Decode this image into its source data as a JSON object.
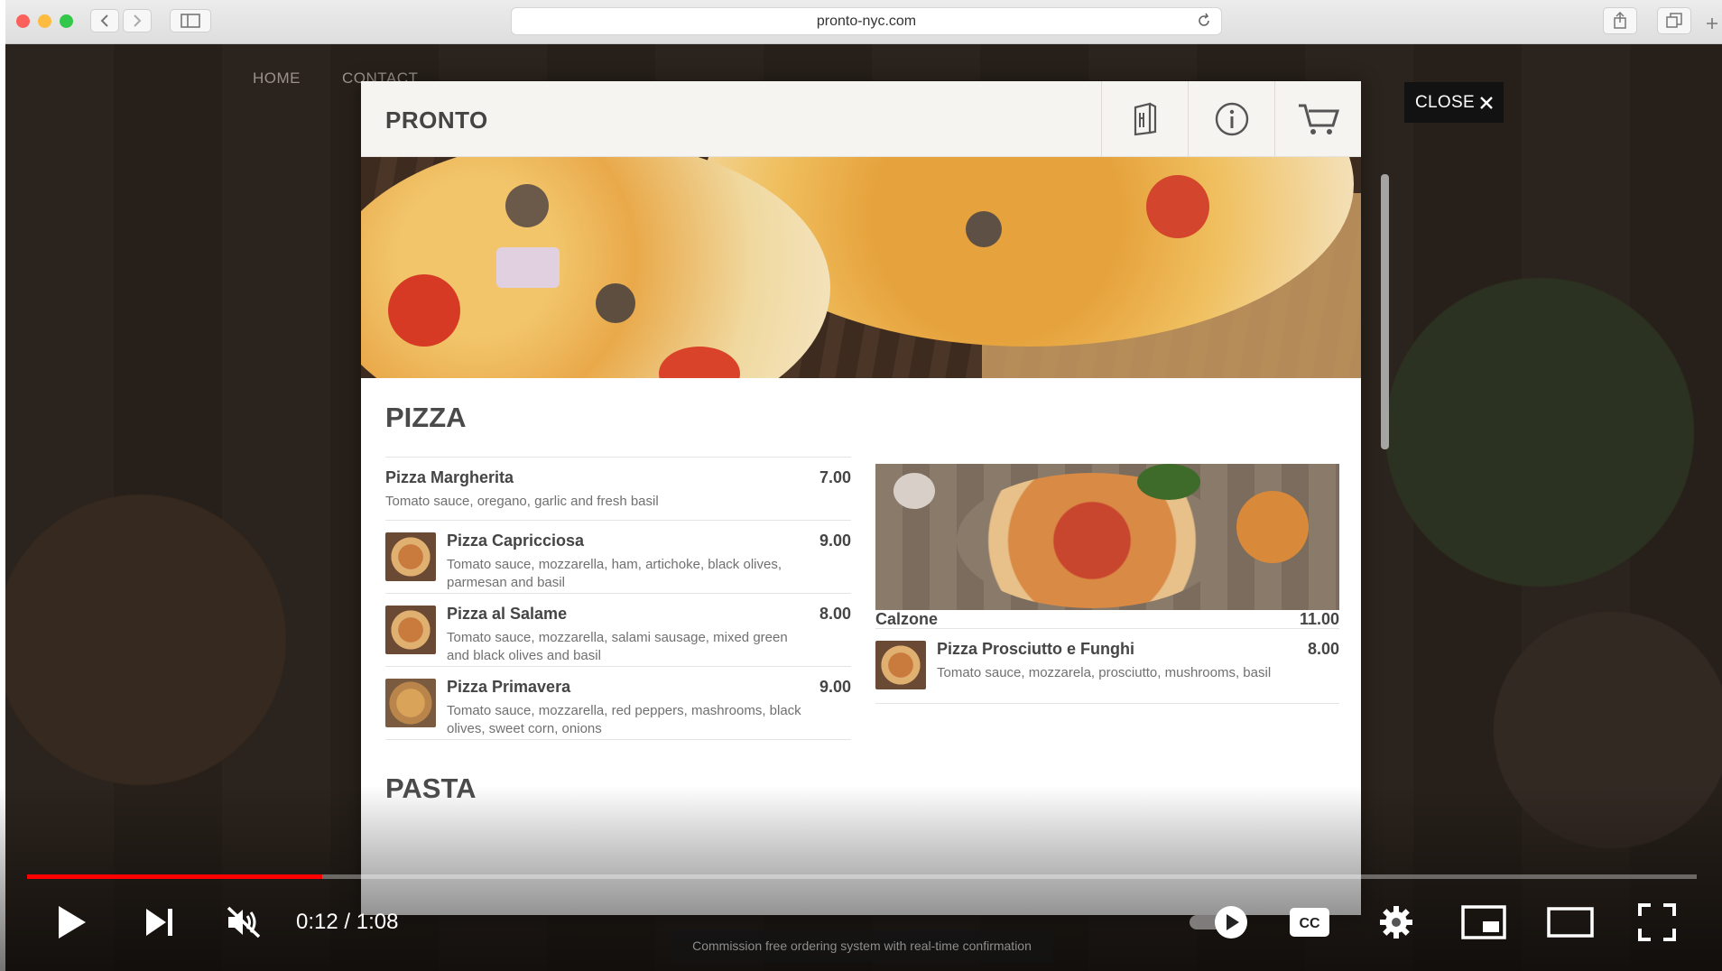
{
  "browser": {
    "url": "pronto-nyc.com"
  },
  "background_nav": {
    "home": "HOME",
    "contact": "CONTACT"
  },
  "modal": {
    "brand": "PRONTO",
    "close_label": "CLOSE",
    "sections": {
      "pizza_title": "PIZZA",
      "pasta_title": "PASTA"
    },
    "items_left": [
      {
        "name": "Pizza Margherita",
        "price": "7.00",
        "desc": "Tomato sauce, oregano, garlic and fresh basil"
      },
      {
        "name": "Pizza Capricciosa",
        "price": "9.00",
        "desc": "Tomato sauce, mozzarella, ham, artichoke, black olives, parmesan and basil"
      },
      {
        "name": "Pizza al Salame",
        "price": "8.00",
        "desc": "Tomato sauce, mozzarella, salami sausage, mixed green and black olives and basil"
      },
      {
        "name": "Pizza Primavera",
        "price": "9.00",
        "desc": "Tomato sauce, mozzarella, red peppers, mashrooms, black olives, sweet corn, onions"
      }
    ],
    "items_right": [
      {
        "name": "Calzone",
        "price": "11.00"
      },
      {
        "name": "Pizza Prosciutto e Funghi",
        "price": "8.00",
        "desc": "Tomato sauce, mozzarela, prosciutto, mushrooms, basil"
      }
    ]
  },
  "video": {
    "time": "0:12 / 1:08",
    "progress_fraction": 0.177,
    "caption": "Commission free ordering system with real-time confirmation",
    "cc_label": "CC"
  },
  "colors": {
    "progress": "#ff0000",
    "close_bg": "#121212",
    "heading": "#4a4a4a"
  },
  "icons": [
    "menu-book-icon",
    "info-icon",
    "cart-icon",
    "close-icon",
    "play-icon",
    "next-icon",
    "mute-icon",
    "autoplay-icon",
    "cc-icon",
    "settings-icon",
    "miniplayer-icon",
    "theater-icon",
    "fullscreen-icon"
  ]
}
